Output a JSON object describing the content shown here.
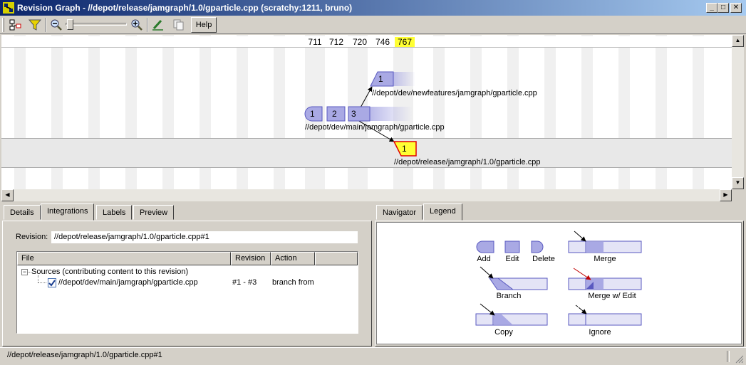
{
  "window": {
    "title": "Revision Graph - //depot/release/jamgraph/1.0/gparticle.cpp (scratchy:1211, bruno)",
    "min_glyph": "_",
    "max_glyph": "□",
    "close_glyph": "✕"
  },
  "toolbar": {
    "help_label": "Help",
    "icons": [
      "tree-icon",
      "filter-icon",
      "zoom-out-icon",
      "zoom-slider",
      "zoom-in-icon",
      "highlight-icon",
      "copy-icon"
    ]
  },
  "graph": {
    "revision_headers": [
      "711",
      "712",
      "720",
      "746",
      "767"
    ],
    "highlighted_header": "767",
    "highlight_color": "#ffff33",
    "nodes": {
      "main_1": "1",
      "main_2": "2",
      "main_3": "3",
      "newfeat_1": "1",
      "release_1": "1"
    },
    "paths": {
      "main": "//depot/dev/main/jamgraph/gparticle.cpp",
      "newfeatures": "//depot/dev/newfeatures/jamgraph/gparticle.cpp",
      "release": "//depot/release/jamgraph/1.0/gparticle.cpp"
    },
    "node_color": "#a9a9e4",
    "node_border": "#5959c0"
  },
  "left_panel": {
    "tabs": [
      "Details",
      "Integrations",
      "Labels",
      "Preview"
    ],
    "active_tab": "Integrations",
    "revision_label": "Revision:",
    "revision_value": "//depot/release/jamgraph/1.0/gparticle.cpp#1",
    "columns": [
      "File",
      "Revision",
      "Action"
    ],
    "tree_root": "Sources (contributing content to this revision)",
    "rows": [
      {
        "file": "//depot/dev/main/jamgraph/gparticle.cpp",
        "revision": "#1 - #3",
        "action": "branch from"
      }
    ]
  },
  "right_panel": {
    "tabs": [
      "Navigator",
      "Legend"
    ],
    "active_tab": "Legend",
    "legend": {
      "add": "Add",
      "edit": "Edit",
      "delete": "Delete",
      "merge": "Merge",
      "branch": "Branch",
      "merge_edit": "Merge w/ Edit",
      "copy": "Copy",
      "ignore": "Ignore"
    }
  },
  "status": {
    "text": "//depot/release/jamgraph/1.0/gparticle.cpp#1"
  }
}
